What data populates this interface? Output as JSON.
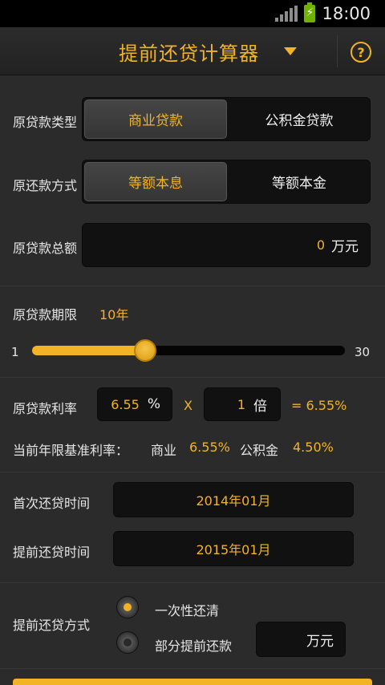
{
  "status": {
    "time": "18:00"
  },
  "header": {
    "title": "提前还贷计算器",
    "help_symbol": "?"
  },
  "loan_type": {
    "label": "原贷款类型",
    "options": [
      "商业贷款",
      "公积金贷款"
    ],
    "selected": 0
  },
  "repay_method": {
    "label": "原还款方式",
    "options": [
      "等额本息",
      "等额本金"
    ],
    "selected": 0
  },
  "loan_amount": {
    "label": "原贷款总额",
    "value": "0",
    "unit": "万元"
  },
  "loan_term": {
    "label": "原贷款期限",
    "value_text": "10年",
    "min": "1",
    "max": "30",
    "value": 10
  },
  "rate": {
    "label": "原贷款利率",
    "value": "6.55",
    "unit": "%",
    "times_symbol": "X",
    "multiplier": "1",
    "multiplier_unit": "倍",
    "result": "= 6.55%"
  },
  "base_rate": {
    "label": "当前年限基准利率：",
    "commercial_label": "商业",
    "commercial_value": "6.55%",
    "fund_label": "公积金",
    "fund_value": "4.50%"
  },
  "first_repay": {
    "label": "首次还贷时间",
    "value": "2014年01月"
  },
  "early_repay": {
    "label": "提前还贷时间",
    "value": "2015年01月"
  },
  "early_method": {
    "label": "提前还贷方式",
    "options": [
      "一次性还清",
      "部分提前还款"
    ],
    "selected": 0,
    "partial_unit": "万元"
  },
  "colors": {
    "accent": "#f2b325",
    "background": "#2b2b2b",
    "field": "#111111"
  }
}
